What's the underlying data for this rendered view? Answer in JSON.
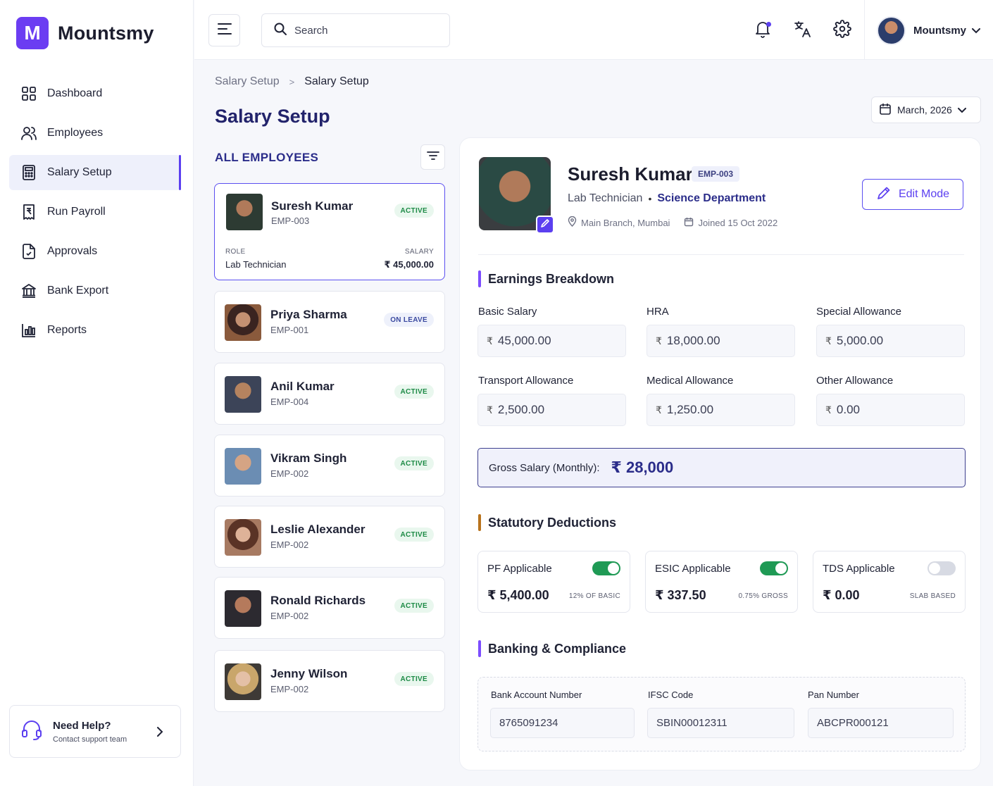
{
  "brand": {
    "logo_letter": "M",
    "name": "Mountsmy",
    "color": "#6b3df2"
  },
  "sidebar": {
    "items": [
      {
        "label": "Dashboard",
        "icon": "grid-icon"
      },
      {
        "label": "Employees",
        "icon": "users-icon"
      },
      {
        "label": "Salary Setup",
        "icon": "calculator-icon",
        "active": true
      },
      {
        "label": "Run Payroll",
        "icon": "receipt-icon"
      },
      {
        "label": "Approvals",
        "icon": "file-check-icon"
      },
      {
        "label": "Bank Export",
        "icon": "bank-icon"
      },
      {
        "label": "Reports",
        "icon": "bar-chart-icon"
      }
    ],
    "help": {
      "title": "Need Help?",
      "subtitle": "Contact support team"
    }
  },
  "topbar": {
    "search_placeholder": "Search",
    "user_name": "Mountsmy"
  },
  "breadcrumb": {
    "parent": "Salary Setup",
    "separator": ">",
    "current": "Salary Setup"
  },
  "page_title": "Salary Setup",
  "month_picker": {
    "value": "March, 2026"
  },
  "employee_list": {
    "heading": "ALL EMPLOYEES",
    "employees": [
      {
        "name": "Suresh Kumar",
        "id": "EMP-003",
        "status": "ACTIVE",
        "role_label": "ROLE",
        "role": "Lab Technician",
        "salary_label": "SALARY",
        "salary": "₹ 45,000.00"
      },
      {
        "name": "Priya Sharma",
        "id": "EMP-001",
        "status": "ON LEAVE"
      },
      {
        "name": "Anil Kumar",
        "id": "EMP-004",
        "status": "ACTIVE"
      },
      {
        "name": "Vikram Singh",
        "id": "EMP-002",
        "status": "ACTIVE"
      },
      {
        "name": "Leslie Alexander",
        "id": "EMP-002",
        "status": "ACTIVE"
      },
      {
        "name": "Ronald Richards",
        "id": "EMP-002",
        "status": "ACTIVE"
      },
      {
        "name": "Jenny Wilson",
        "id": "EMP-002",
        "status": "ACTIVE"
      }
    ]
  },
  "detail": {
    "name": "Suresh Kumar",
    "emp_id": "EMP-003",
    "role": "Lab Technician",
    "role_separator": "•",
    "department": "Science Department",
    "location": "Main Branch, Mumbai",
    "joined": "Joined 15 Oct 2022",
    "edit_mode_label": "Edit Mode",
    "currency_symbol": "₹",
    "earnings": {
      "title": "Earnings Breakdown",
      "fields": [
        {
          "label": "Basic Salary",
          "value": "45,000.00"
        },
        {
          "label": "HRA",
          "value": "18,000.00"
        },
        {
          "label": "Special Allowance",
          "value": "5,000.00"
        },
        {
          "label": "Transport Allowance",
          "value": "2,500.00"
        },
        {
          "label": "Medical Allowance",
          "value": "1,250.00"
        },
        {
          "label": "Other Allowance",
          "value": "0.00"
        }
      ]
    },
    "gross": {
      "label": "Gross Salary (Monthly):",
      "value": "₹ 28,000"
    },
    "deductions": {
      "title": "Statutory Deductions",
      "items": [
        {
          "label": "PF Applicable",
          "enabled": true,
          "amount": "₹ 5,400.00",
          "note": "12% OF BASIC"
        },
        {
          "label": "ESIC Applicable",
          "enabled": true,
          "amount": "₹ 337.50",
          "note": "0.75% GROSS"
        },
        {
          "label": "TDS Applicable",
          "enabled": false,
          "amount": "₹ 0.00",
          "note": "SLAB BASED"
        }
      ]
    },
    "banking": {
      "title": "Banking & Compliance",
      "fields": [
        {
          "label": "Bank Account Number",
          "value": "8765091234"
        },
        {
          "label": "IFSC Code",
          "value": "SBIN00012311"
        },
        {
          "label": "Pan Number",
          "value": "ABCPR000121"
        }
      ]
    }
  },
  "colors": {
    "accent": "#5b3ff0",
    "title": "#22236b",
    "active_badge_bg": "#e9f7ee",
    "active_badge_text": "#1c8a45",
    "toggle_on": "#1f9a55"
  }
}
